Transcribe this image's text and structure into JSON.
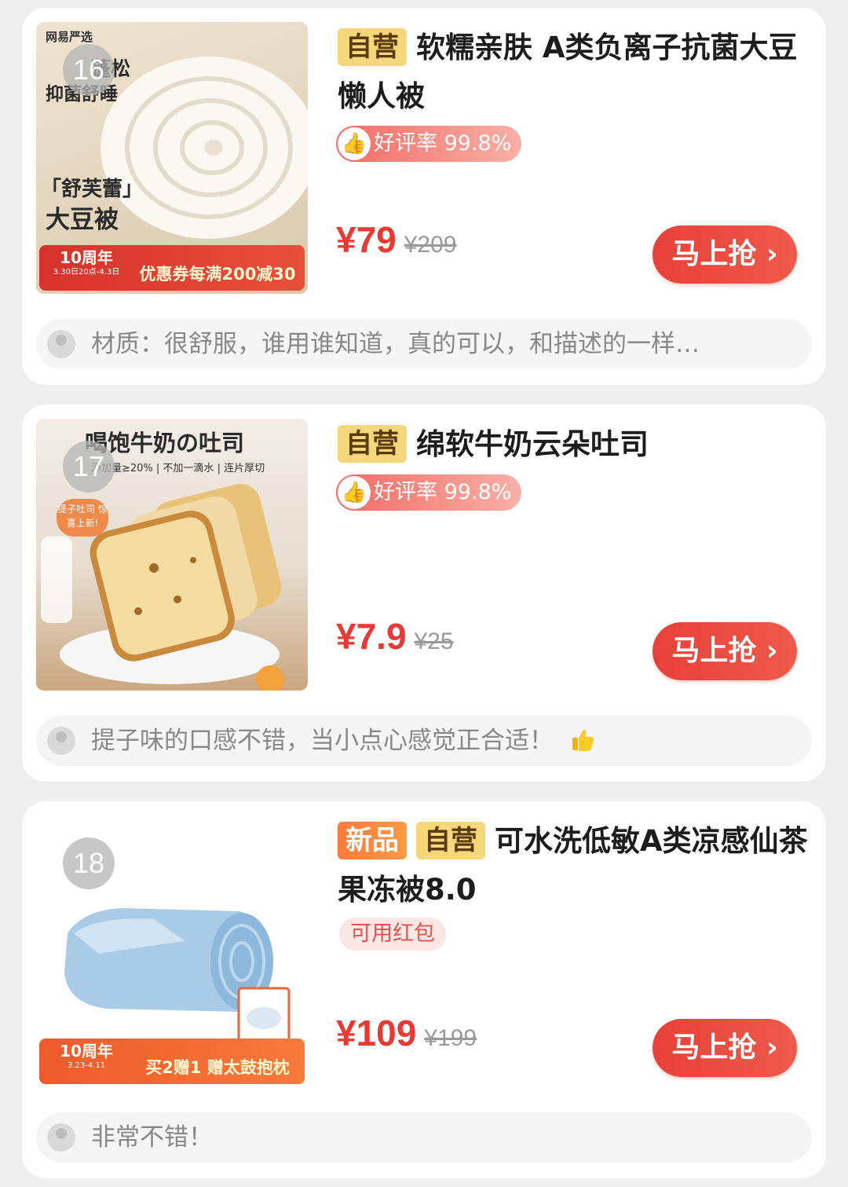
{
  "products": [
    {
      "rank": "16",
      "tags": [
        "自营"
      ],
      "title": "软糯亲肤 A类负离子抗菌大豆懒人被",
      "rating": "好评率 99.8%",
      "price_now": "¥79",
      "price_old": "¥209",
      "buy_label": "马上抢 ›",
      "review": "材质：很舒服，谁用谁知道，真的可以，和描述的一样…",
      "thumb": {
        "brand": "网易严选",
        "headline_1": "蓬松",
        "headline_2": "抑菌舒睡",
        "caption_1": "「舒芙蕾」",
        "caption_2": "大豆被",
        "promo_left": "10周年",
        "promo_left_small": "3.30日20点-4.3日",
        "promo_right": "优惠券每满200减30"
      }
    },
    {
      "rank": "17",
      "tags": [
        "自营"
      ],
      "title": "绵软牛奶云朵吐司",
      "rating": "好评率 99.8%",
      "price_now": "¥7.9",
      "price_old": "¥25",
      "buy_label": "马上抢 ›",
      "review": "提子味的口感不错，当小点心感觉正合适！",
      "thumb": {
        "headline": "喝饱牛奶の吐司",
        "subline": "添加量≥20% | 不加一滴水 | 连片厚切",
        "sticker": "提子吐司 惊喜上新!"
      }
    },
    {
      "rank": "18",
      "tags": [
        "新品",
        "自营"
      ],
      "title": "可水洗低敏A类凉感仙茶果冻被8.0",
      "coupon": "可用红包",
      "price_now": "¥109",
      "price_old": "¥199",
      "buy_label": "马上抢 ›",
      "review": "非常不错！",
      "thumb": {
        "promo_left": "10周年",
        "promo_left_small": "3.23-4.11",
        "promo_right": "买2赠1 赠太鼓抱枕"
      }
    }
  ],
  "colors": {
    "accent_red": "#e63a35",
    "tag_self_bg": "#f6d77c",
    "tag_new_bg": "#ff7a3d",
    "page_bg": "#efefef"
  },
  "icons": [
    "thumb-up-icon",
    "avatar-icon",
    "thumbs-up-emoji-icon"
  ]
}
